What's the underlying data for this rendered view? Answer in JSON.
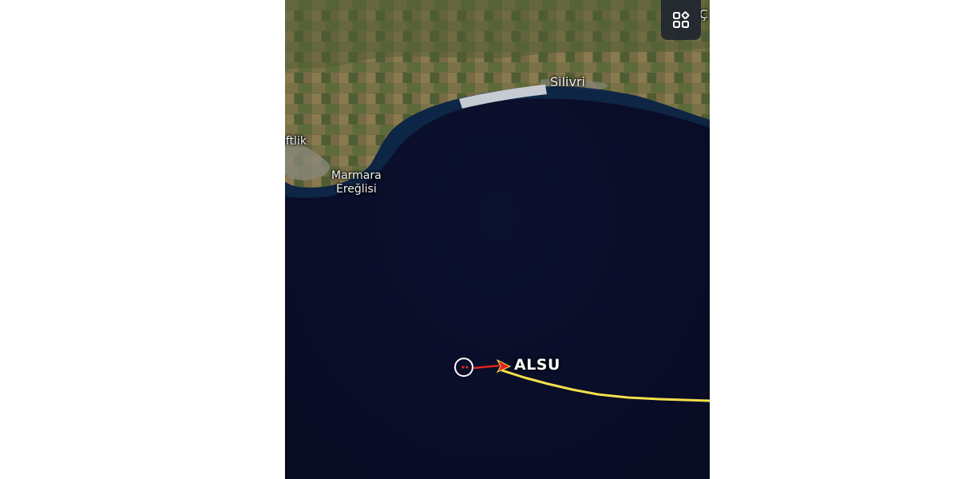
{
  "map": {
    "places": {
      "silivri": "Silivri",
      "ciftlik": "iftlik",
      "marmara_line1": "Marmara",
      "marmara_line2": "Ereğlisi",
      "edge_c": "Ç"
    },
    "vessel": {
      "name": "ALSU"
    },
    "controls": {
      "layers_icon": "layers-grid-icon"
    },
    "colors": {
      "sea": "#0b0f2b",
      "land": "#6f6a45",
      "track": "#f5e04a",
      "heading_vector": "#e0261b",
      "selection_ring": "#ffffff"
    }
  }
}
